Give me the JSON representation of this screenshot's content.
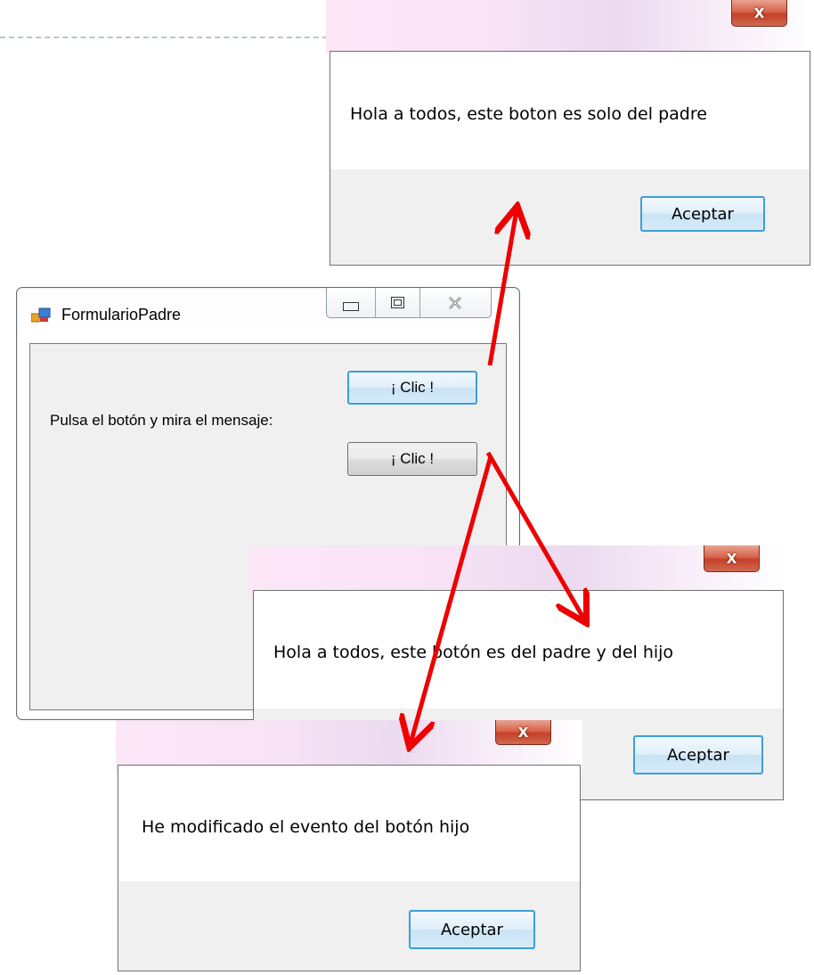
{
  "parent_form": {
    "title": "FormularioPadre",
    "label": "Pulsa el botón y mira el mensaje:",
    "button_top_label": "¡ Clic !",
    "button_bottom_label": "¡ Clic !",
    "minimize_glyph": "▭",
    "maximize_glyph": "▣",
    "close_glyph": "✕"
  },
  "message_boxes": [
    {
      "text": "Hola a todos, este boton es solo del padre",
      "ok_label": "Aceptar",
      "close_glyph": "X"
    },
    {
      "text": "Hola a todos, este botón es del padre y del hijo",
      "ok_label": "Aceptar",
      "close_glyph": "X"
    },
    {
      "text": "He modificado el evento del botón hijo",
      "ok_label": "Aceptar",
      "close_glyph": "X"
    }
  ],
  "colors": {
    "arrow": "#ee0000",
    "focus_border": "#3c9fd7",
    "close_button": "#c44128"
  },
  "icons": [
    "close-icon",
    "minimize-icon",
    "maximize-icon",
    "app-icon"
  ]
}
